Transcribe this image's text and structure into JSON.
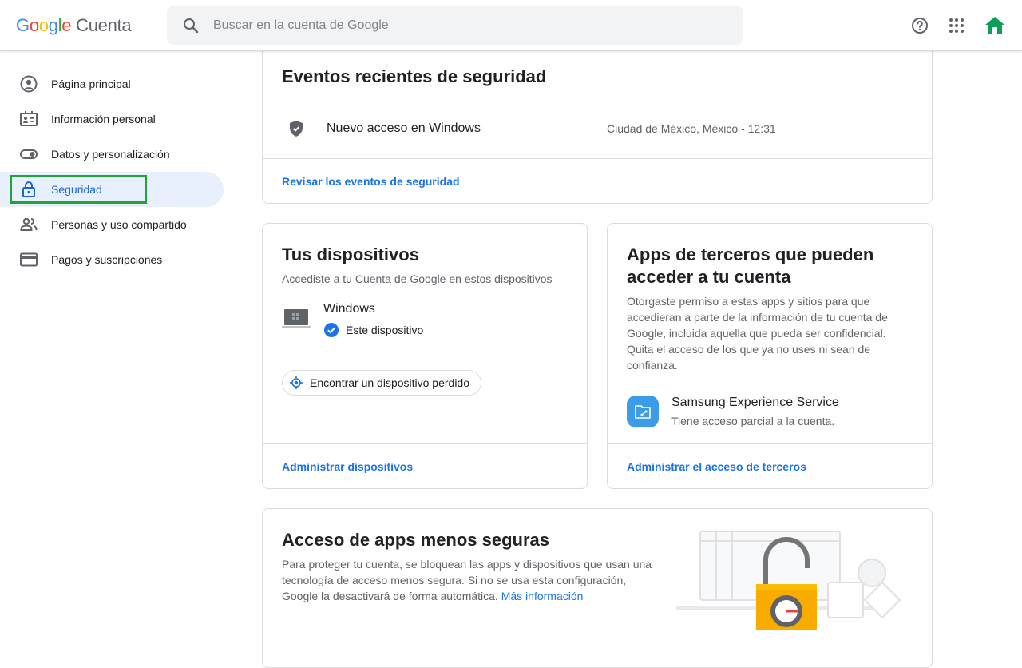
{
  "header": {
    "logo_letters": [
      "G",
      "o",
      "o",
      "g",
      "l",
      "e"
    ],
    "product": "Cuenta",
    "search_placeholder": "Buscar en la cuenta de Google",
    "icons": [
      "search-icon",
      "help-icon",
      "apps-grid-icon",
      "account-avatar-icon"
    ]
  },
  "sidebar": {
    "items": [
      {
        "label": "Página principal",
        "icon": "account-circle-icon"
      },
      {
        "label": "Información personal",
        "icon": "id-card-icon"
      },
      {
        "label": "Datos y personalización",
        "icon": "toggle-icon"
      },
      {
        "label": "Seguridad",
        "icon": "lock-icon",
        "active": true
      },
      {
        "label": "Personas y uso compartido",
        "icon": "people-icon"
      },
      {
        "label": "Pagos y suscripciones",
        "icon": "credit-card-icon"
      }
    ]
  },
  "events": {
    "title": "Eventos recientes de seguridad",
    "event_name": "Nuevo acceso en Windows",
    "event_meta": "Ciudad de México, México - 12:31",
    "footer_link": "Revisar los eventos de seguridad"
  },
  "devices": {
    "title": "Tus dispositivos",
    "desc": "Accediste a tu Cuenta de Google en estos dispositivos",
    "device_name": "Windows",
    "this_device": "Este dispositivo",
    "find_button": "Encontrar un dispositivo perdido",
    "footer_link": "Administrar dispositivos"
  },
  "thirdparty": {
    "title": "Apps de terceros que pueden acceder a tu cuenta",
    "desc": "Otorgaste permiso a estas apps y sitios para que accedieran a parte de la información de tu cuenta de Google, incluida aquella que pueda ser confidencial. Quita el acceso de los que ya no uses ni sean de confianza.",
    "app_name": "Samsung Experience Service",
    "app_access": "Tiene acceso parcial a la cuenta.",
    "footer_link": "Administrar el acceso de terceros"
  },
  "lesssecure": {
    "title": "Acceso de apps menos seguras",
    "desc": "Para proteger tu cuenta, se bloquean las apps y dispositivos que usan una tecnología de acceso menos segura. Si no se usa esta configuración, Google la desactivará de forma automática.",
    "more_link": "Más información"
  },
  "colors": {
    "accent_blue": "#1a73e8",
    "active_bg": "#e8f0fe",
    "highlight_green": "#1ea535",
    "avatar_green": "#0f9d58"
  }
}
